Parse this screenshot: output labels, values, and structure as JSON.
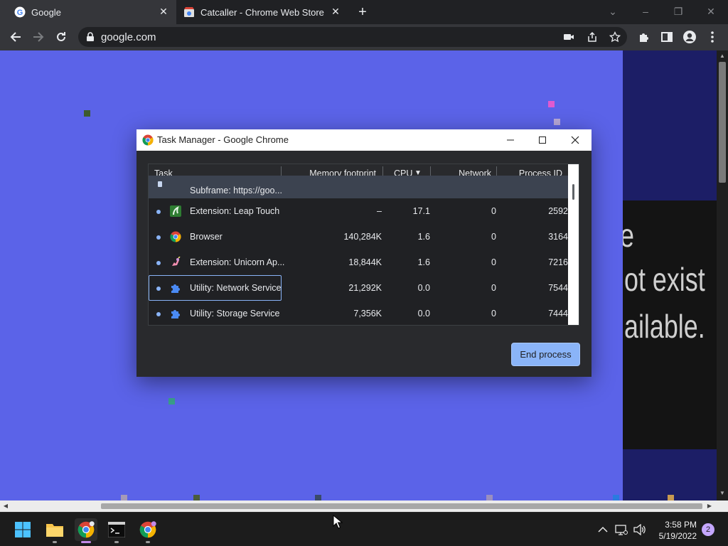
{
  "browser": {
    "tabs": [
      {
        "title": "Google",
        "favicon": "google-g-icon",
        "active": true
      },
      {
        "title": "Catcaller - Chrome Web Store",
        "favicon": "chrome-web-store-icon",
        "active": false
      }
    ],
    "new_tab_icon": "plus-icon",
    "url": "google.com"
  },
  "page": {
    "partial_text_lines": [
      "e",
      "ot exist",
      "ailable."
    ]
  },
  "task_manager": {
    "title": "Task Manager - Google Chrome",
    "columns": [
      {
        "label": "Task"
      },
      {
        "label": "Memory footprint"
      },
      {
        "label": "CPU",
        "sorted": "desc",
        "sort_glyph": "▼"
      },
      {
        "label": "Network"
      },
      {
        "label": "Process ID"
      }
    ],
    "rows": [
      {
        "task": "Subframe: https://goo...",
        "memory": "",
        "cpu": "",
        "network": "",
        "pid": "",
        "icon": "subframe-icon",
        "selected": true
      },
      {
        "task": "Extension: Leap Touch",
        "memory": "–",
        "cpu": "17.1",
        "network": "0",
        "pid": "2592",
        "icon": "leap-touch-icon"
      },
      {
        "task": "Browser",
        "memory": "140,284K",
        "cpu": "1.6",
        "network": "0",
        "pid": "3164",
        "icon": "chrome-icon"
      },
      {
        "task": "Extension: Unicorn Ap...",
        "memory": "18,844K",
        "cpu": "1.6",
        "network": "0",
        "pid": "7216",
        "icon": "unicorn-icon"
      },
      {
        "task": "Utility: Network Service",
        "memory": "21,292K",
        "cpu": "0.0",
        "network": "0",
        "pid": "7544",
        "icon": "puzzle-icon",
        "focused": true
      },
      {
        "task": "Utility: Storage Service",
        "memory": "7,356K",
        "cpu": "0.0",
        "network": "0",
        "pid": "7444",
        "icon": "puzzle-icon"
      }
    ],
    "end_process_label": "End process"
  },
  "taskbar": {
    "time": "3:58 PM",
    "date": "5/19/2022",
    "notification_count": "2"
  },
  "colors": {
    "page_background": "#5b63e8",
    "accent_blue": "#8ab4f8",
    "chrome_dark": "#202124",
    "chrome_toolbar": "#35363a"
  }
}
